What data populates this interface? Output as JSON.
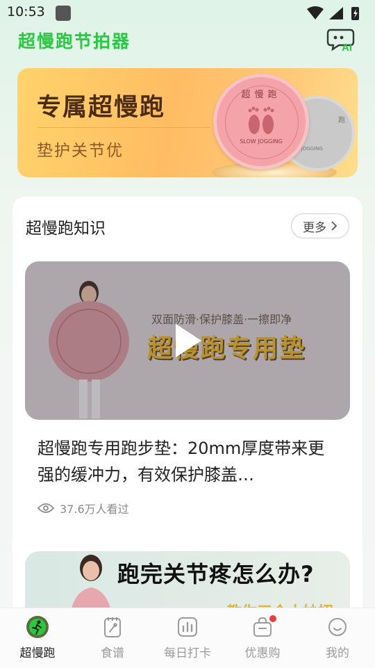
{
  "status_bar": {
    "time": "10:53"
  },
  "header": {
    "title": "超慢跑节拍器",
    "ai_label": "AI"
  },
  "banner": {
    "title": "专属超慢跑",
    "subtitle": "垫护关节优",
    "coin_text": "超慢跑",
    "coin_bottom": "SLOW JOGGING"
  },
  "knowledge": {
    "section_title": "超慢跑知识",
    "more_label": "更多",
    "videos": [
      {
        "thumb_top_caption": "双面防滑·保护膝盖·一擦即净",
        "thumb_big_caption": "超慢跑专用垫",
        "title": "超慢跑专用跑步垫：20mm厚度带来更强的缓冲力，有效保护膝盖…",
        "views": "37.6万人看过"
      },
      {
        "thumb_caption": "跑完关节疼怎么办?",
        "thumb_sub": "教你三个小妙招"
      }
    ]
  },
  "tabs": [
    {
      "label": "超慢跑",
      "icon": "run-icon",
      "active": true
    },
    {
      "label": "食谱",
      "icon": "recipe-icon",
      "active": false
    },
    {
      "label": "每日打卡",
      "icon": "checkin-icon",
      "active": false
    },
    {
      "label": "优惠购",
      "icon": "shop-bag-icon",
      "active": false,
      "badge": true
    },
    {
      "label": "我的",
      "icon": "profile-icon",
      "active": false
    }
  ],
  "colors": {
    "brand_green": "#27c93f",
    "badge_red": "#f23c3c"
  }
}
